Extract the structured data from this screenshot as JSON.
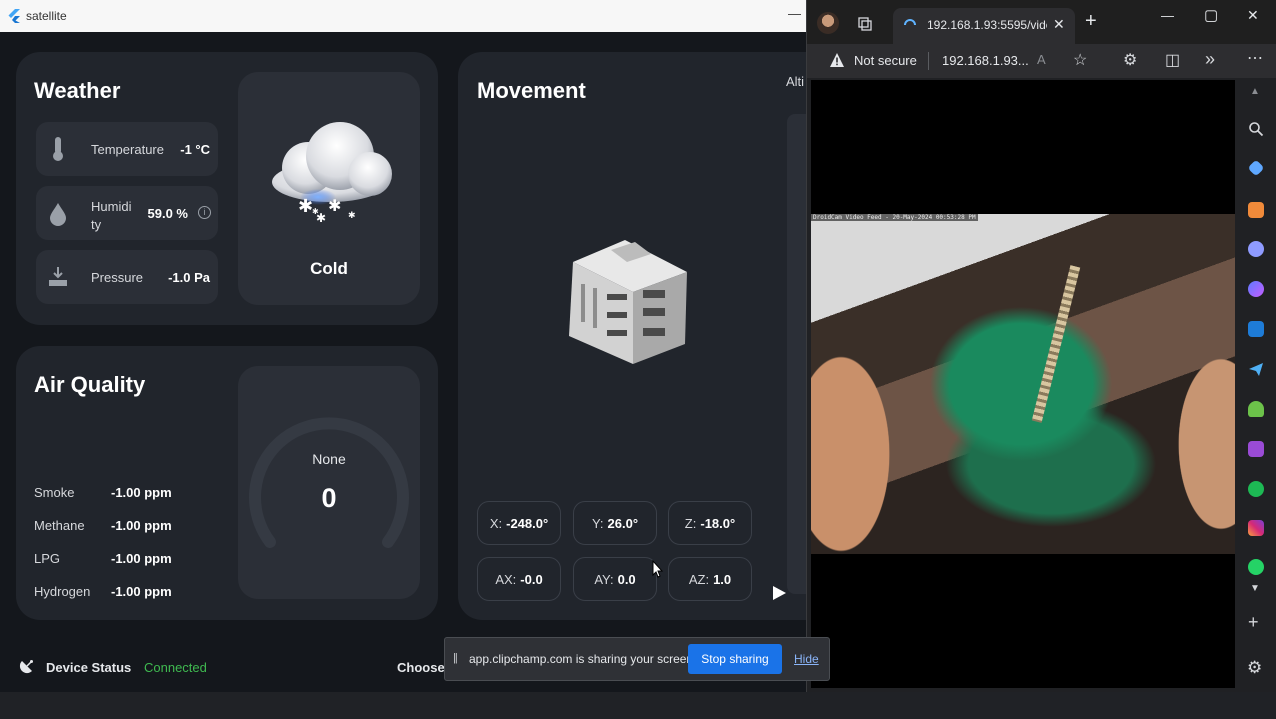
{
  "app": {
    "title": "satellite",
    "minimize_glyph": "—",
    "weather": {
      "title": "Weather",
      "rows": [
        {
          "label": "Temperature",
          "value": "-1 °C",
          "icon": "thermometer-icon"
        },
        {
          "label": "Humidi ty",
          "value": "59.0 %",
          "icon": "water-drop-icon"
        },
        {
          "label": "Pressure",
          "value": "-1.0 Pa",
          "icon": "pressure-icon"
        }
      ],
      "condition": "Cold",
      "info_glyph": "i"
    },
    "air_quality": {
      "title": "Air Quality",
      "rows": [
        {
          "label": "Smoke",
          "value": "-1.00 ppm"
        },
        {
          "label": "Methane",
          "value": "-1.00 ppm"
        },
        {
          "label": "LPG",
          "value": "-1.00 ppm"
        },
        {
          "label": "Hydrogen",
          "value": "-1.00 ppm"
        }
      ],
      "gauge_label": "None",
      "gauge_value": "0"
    },
    "movement": {
      "title": "Movement",
      "partial_label": "Alti",
      "coords": [
        {
          "label": "X:",
          "value": "-248.0°"
        },
        {
          "label": "Y:",
          "value": "26.0°"
        },
        {
          "label": "Z:",
          "value": "-18.0°"
        },
        {
          "label": "AX:",
          "value": "-0.0"
        },
        {
          "label": "AY:",
          "value": "0.0"
        },
        {
          "label": "AZ:",
          "value": "1.0"
        }
      ]
    },
    "status": {
      "label": "Device Status",
      "value": "Connected",
      "choose_label": "Choose"
    },
    "colors": {
      "accent_green": "#3fb950",
      "card": "#21252c",
      "background": "#14171c"
    }
  },
  "browser": {
    "tab_title": "192.168.1.93:5595/vide",
    "security_label": "Not secure",
    "url": "192.168.1.93...",
    "video_overlay_text": "DroidCam Video Feed - 20-May-2024 00:53:28 PM",
    "win_controls": {
      "minimize": "—",
      "maximize": "▢",
      "close": "✕"
    }
  },
  "share_bar": {
    "message": "app.clipchamp.com is sharing your screen.",
    "stop_label": "Stop sharing",
    "hide_label": "Hide"
  }
}
